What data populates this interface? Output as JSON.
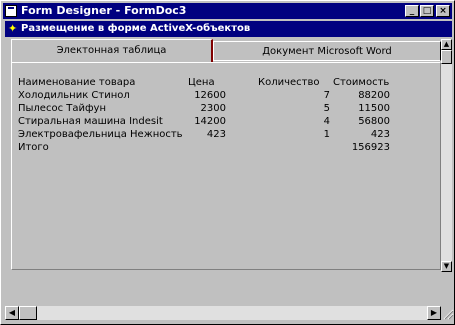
{
  "window": {
    "title": "Form Designer - FormDoc3",
    "buttons": {
      "minimize": "_",
      "maximize": "□",
      "close": "×"
    }
  },
  "child_window": {
    "title": "Размещение в форме ActiveX-объектов"
  },
  "tabs": [
    {
      "label": "Электонная таблица",
      "active": true
    },
    {
      "label": "Документ Microsoft Word",
      "active": false
    }
  ],
  "table": {
    "headers": [
      "Наименование товара",
      "Цена",
      "Количество",
      "Стоимость"
    ],
    "rows": [
      [
        "Холодильник Стинол",
        "12600",
        "7",
        "88200"
      ],
      [
        "Пылесос Тайфун",
        "2300",
        "5",
        "11500"
      ],
      [
        "Стиральная машина Indesit",
        "14200",
        "4",
        "56800"
      ],
      [
        "Электровафельница Нежность",
        "423",
        "1",
        "423"
      ]
    ],
    "total_label": "Итого",
    "total_value": "156923"
  },
  "colors": {
    "title_bar": "#000080",
    "face": "#c0c0c0",
    "tab_accent": "#800000"
  }
}
